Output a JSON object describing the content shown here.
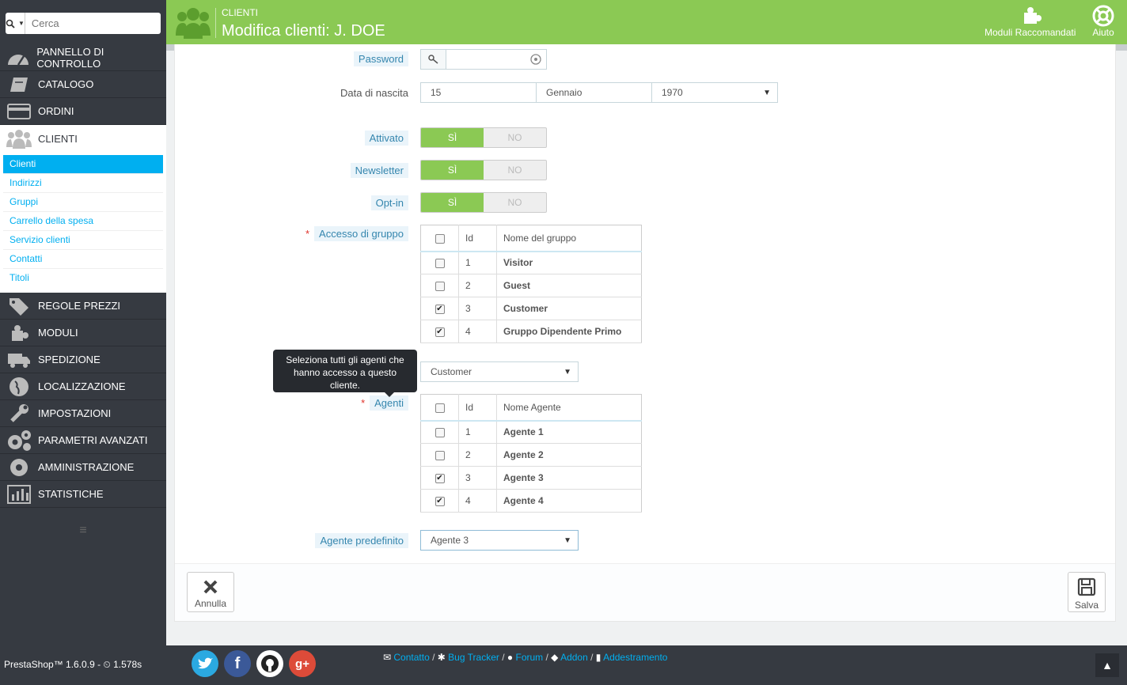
{
  "search": {
    "placeholder": "Cerca"
  },
  "header": {
    "breadcrumb": "CLIENTI",
    "title": "Modifica clienti: J. DOE",
    "modules_label": "Moduli Raccomandati",
    "help_label": "Aiuto"
  },
  "sidebar": {
    "items_top": [
      {
        "label": "PANNELLO DI CONTROLLO",
        "icon": "dashboard-icon"
      },
      {
        "label": "CATALOGO",
        "icon": "book-icon"
      },
      {
        "label": "ORDINI",
        "icon": "credit-card-icon"
      },
      {
        "label": "CLIENTI",
        "icon": "users-icon"
      }
    ],
    "subitems": [
      "Clienti",
      "Indirizzi",
      "Gruppi",
      "Carrello della spesa",
      "Servizio clienti",
      "Contatti",
      "Titoli"
    ],
    "items_bottom": [
      {
        "label": "REGOLE PREZZI",
        "icon": "tags-icon"
      },
      {
        "label": "MODULI",
        "icon": "puzzle-icon"
      },
      {
        "label": "SPEDIZIONE",
        "icon": "truck-icon"
      },
      {
        "label": "LOCALIZZAZIONE",
        "icon": "globe-icon"
      },
      {
        "label": "IMPOSTAZIONI",
        "icon": "wrench-icon"
      },
      {
        "label": "PARAMETRI AVANZATI",
        "icon": "cogs-icon"
      },
      {
        "label": "AMMINISTRAZIONE",
        "icon": "gear-icon"
      },
      {
        "label": "STATISTICHE",
        "icon": "bar-chart-icon"
      }
    ]
  },
  "form": {
    "password_label": "Password",
    "password_value": "",
    "birth_label": "Data di nascita",
    "birth_day": "15",
    "birth_month": "Gennaio",
    "birth_year": "1970",
    "active_label": "Attivato",
    "newsletter_label": "Newsletter",
    "optin_label": "Opt-in",
    "yes": "SÌ",
    "no": "NO",
    "group_access_label": "Accesso di gruppo",
    "group_headers": {
      "id": "Id",
      "name": "Nome del gruppo"
    },
    "groups": [
      {
        "id": "1",
        "name": "Visitor",
        "checked": false
      },
      {
        "id": "2",
        "name": "Guest",
        "checked": false
      },
      {
        "id": "3",
        "name": "Customer",
        "checked": true
      },
      {
        "id": "4",
        "name": "Gruppo Dipendente Primo",
        "checked": true
      }
    ],
    "default_group_value": "Customer",
    "agents_label": "Agenti",
    "agent_headers": {
      "id": "Id",
      "name": "Nome Agente"
    },
    "agents": [
      {
        "id": "1",
        "name": "Agente 1",
        "checked": false
      },
      {
        "id": "2",
        "name": "Agente 2",
        "checked": false
      },
      {
        "id": "3",
        "name": "Agente 3",
        "checked": true
      },
      {
        "id": "4",
        "name": "Agente 4",
        "checked": true
      }
    ],
    "default_agent_label": "Agente predefinito",
    "default_agent_value": "Agente 3",
    "tooltip": "Seleziona tutti gli agenti che hanno accesso a questo cliente.",
    "cancel_label": "Annulla",
    "save_label": "Salva"
  },
  "footer": {
    "version": "PrestaShop™ 1.6.0.9 - ",
    "load_time": "1.578s",
    "links": [
      "Contatto",
      "Bug Tracker",
      "Forum",
      "Addon",
      "Addestramento"
    ]
  },
  "colors": {
    "brand_green": "#8bc954",
    "sidebar_dark": "#363a41",
    "link_blue": "#00aff0"
  }
}
